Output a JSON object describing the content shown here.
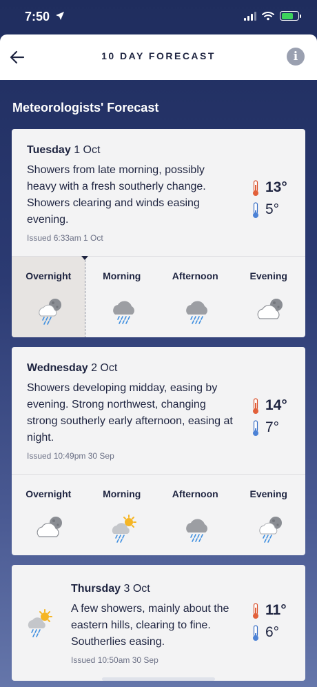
{
  "status": {
    "time": "7:50"
  },
  "header": {
    "title": "10 DAY FORECAST"
  },
  "section_title": "Meteorologists' Forecast",
  "days": [
    {
      "day": "Tuesday",
      "date": "1 Oct",
      "summary": "Showers from late morning, possibly heavy with a fresh southerly change. Showers clearing and winds easing evening.",
      "issued": "Issued 6:33am 1 Oct",
      "max": "13°",
      "min": "5°",
      "periods": [
        {
          "label": "Overnight",
          "icon": "night-showers-icon"
        },
        {
          "label": "Morning",
          "icon": "showers-icon"
        },
        {
          "label": "Afternoon",
          "icon": "showers-icon"
        },
        {
          "label": "Evening",
          "icon": "night-cloudy-icon"
        }
      ]
    },
    {
      "day": "Wednesday",
      "date": "2 Oct",
      "summary": "Showers developing midday, easing by evening. Strong northwest, changing strong southerly early afternoon, easing at night.",
      "issued": "Issued 10:49pm 30 Sep",
      "max": "14°",
      "min": "7°",
      "periods": [
        {
          "label": "Overnight",
          "icon": "night-cloudy-icon"
        },
        {
          "label": "Morning",
          "icon": "sun-showers-icon"
        },
        {
          "label": "Afternoon",
          "icon": "showers-icon"
        },
        {
          "label": "Evening",
          "icon": "night-showers-icon"
        }
      ]
    },
    {
      "day": "Thursday",
      "date": "3 Oct",
      "summary": "A few showers, mainly about the eastern hills, clearing to fine. Southerlies easing.",
      "issued": "Issued 10:50am 30 Sep",
      "max": "11°",
      "min": "6°",
      "icon": "sun-showers-icon"
    }
  ],
  "colors": {
    "thermo_max": "#e2603a",
    "thermo_min": "#4c82d6",
    "rain": "#3f8fe0",
    "sun": "#f5b525"
  }
}
